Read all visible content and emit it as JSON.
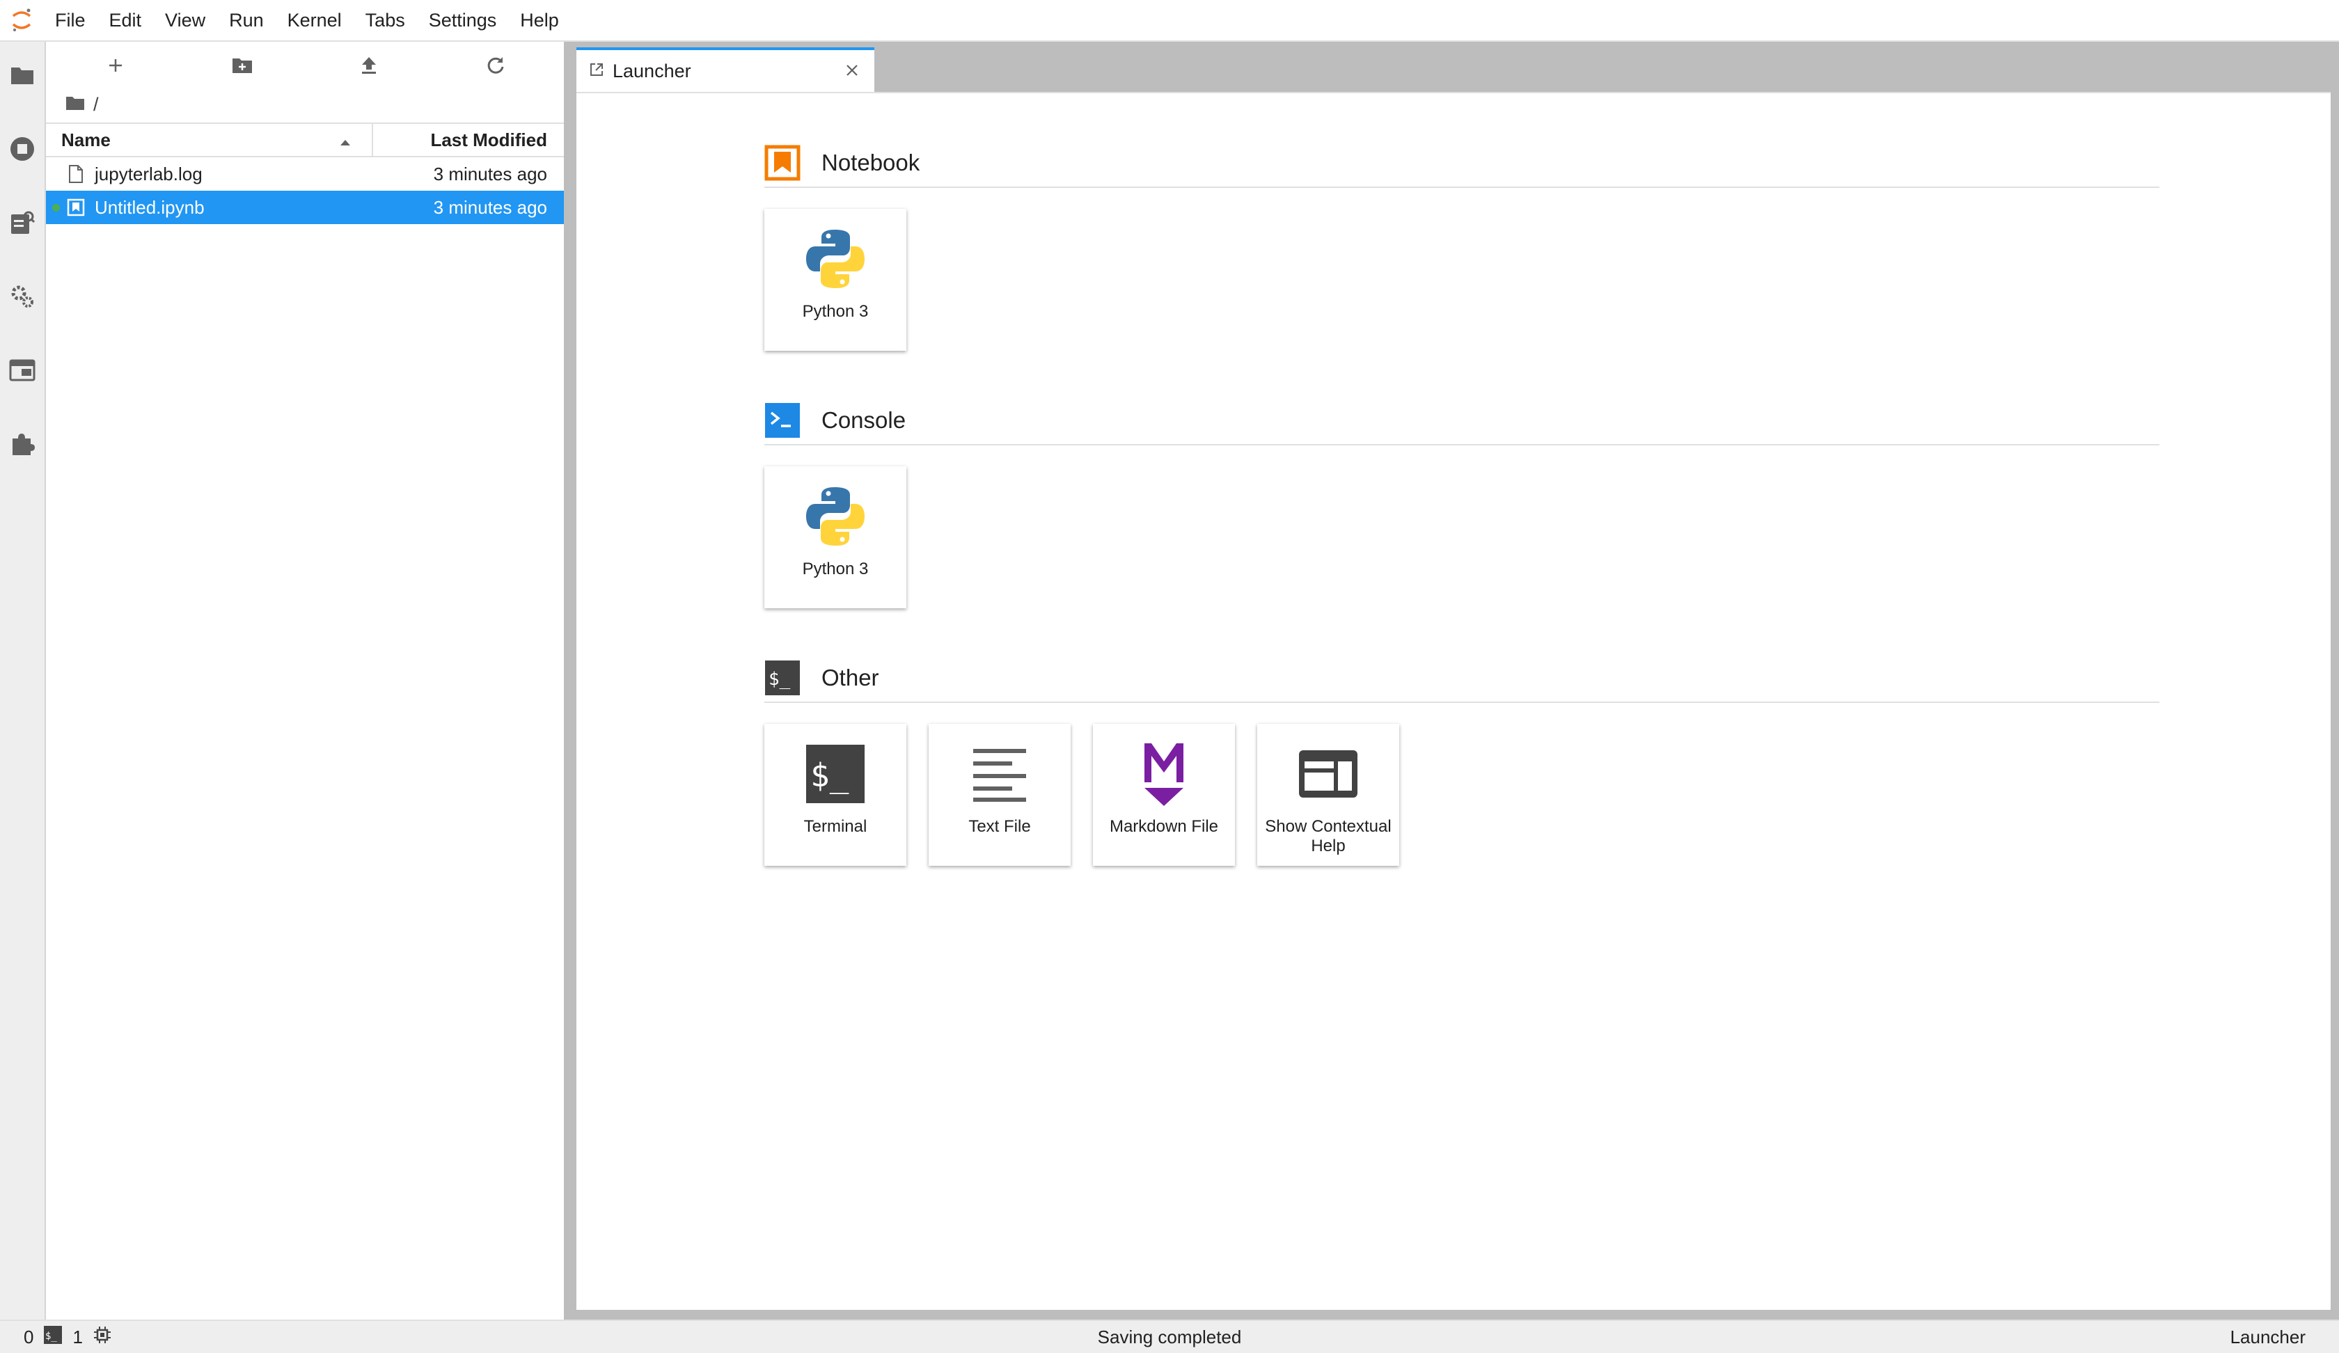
{
  "menubar": {
    "items": [
      "File",
      "Edit",
      "View",
      "Run",
      "Kernel",
      "Tabs",
      "Settings",
      "Help"
    ]
  },
  "activitybar": {
    "icons": [
      "folder-icon",
      "running-icon",
      "commands-icon",
      "property-inspector-icon",
      "tabs-icon",
      "extensions-icon"
    ]
  },
  "filebrowser": {
    "breadcrumb": "/",
    "columns": {
      "name": "Name",
      "modified": "Last Modified"
    },
    "files": [
      {
        "name": "jupyterlab.log",
        "modified": "3 minutes ago",
        "type": "file",
        "selected": false,
        "running": false
      },
      {
        "name": "Untitled.ipynb",
        "modified": "3 minutes ago",
        "type": "notebook",
        "selected": true,
        "running": true
      }
    ]
  },
  "tab": {
    "label": "Launcher"
  },
  "launcher": {
    "sections": [
      {
        "title": "Notebook",
        "icon": "notebook-icon",
        "color": "#f57c00",
        "cards": [
          {
            "label": "Python 3",
            "icon": "python-icon"
          }
        ]
      },
      {
        "title": "Console",
        "icon": "console-icon",
        "color": "#1e88e5",
        "cards": [
          {
            "label": "Python 3",
            "icon": "python-icon"
          }
        ]
      },
      {
        "title": "Other",
        "icon": "terminal-section-icon",
        "color": "#424242",
        "cards": [
          {
            "label": "Terminal",
            "icon": "terminal-icon"
          },
          {
            "label": "Text File",
            "icon": "text-file-icon"
          },
          {
            "label": "Markdown File",
            "icon": "markdown-icon"
          },
          {
            "label": "Show Contextual Help",
            "icon": "contextual-help-icon"
          }
        ]
      }
    ]
  },
  "statusbar": {
    "terminals": "0",
    "kernels": "1",
    "message": "Saving completed",
    "mode": "Launcher"
  },
  "colors": {
    "accent": "#2196f3",
    "selected_row": "#2196f3",
    "running": "#4caf50",
    "markdown": "#7b1fa2"
  }
}
